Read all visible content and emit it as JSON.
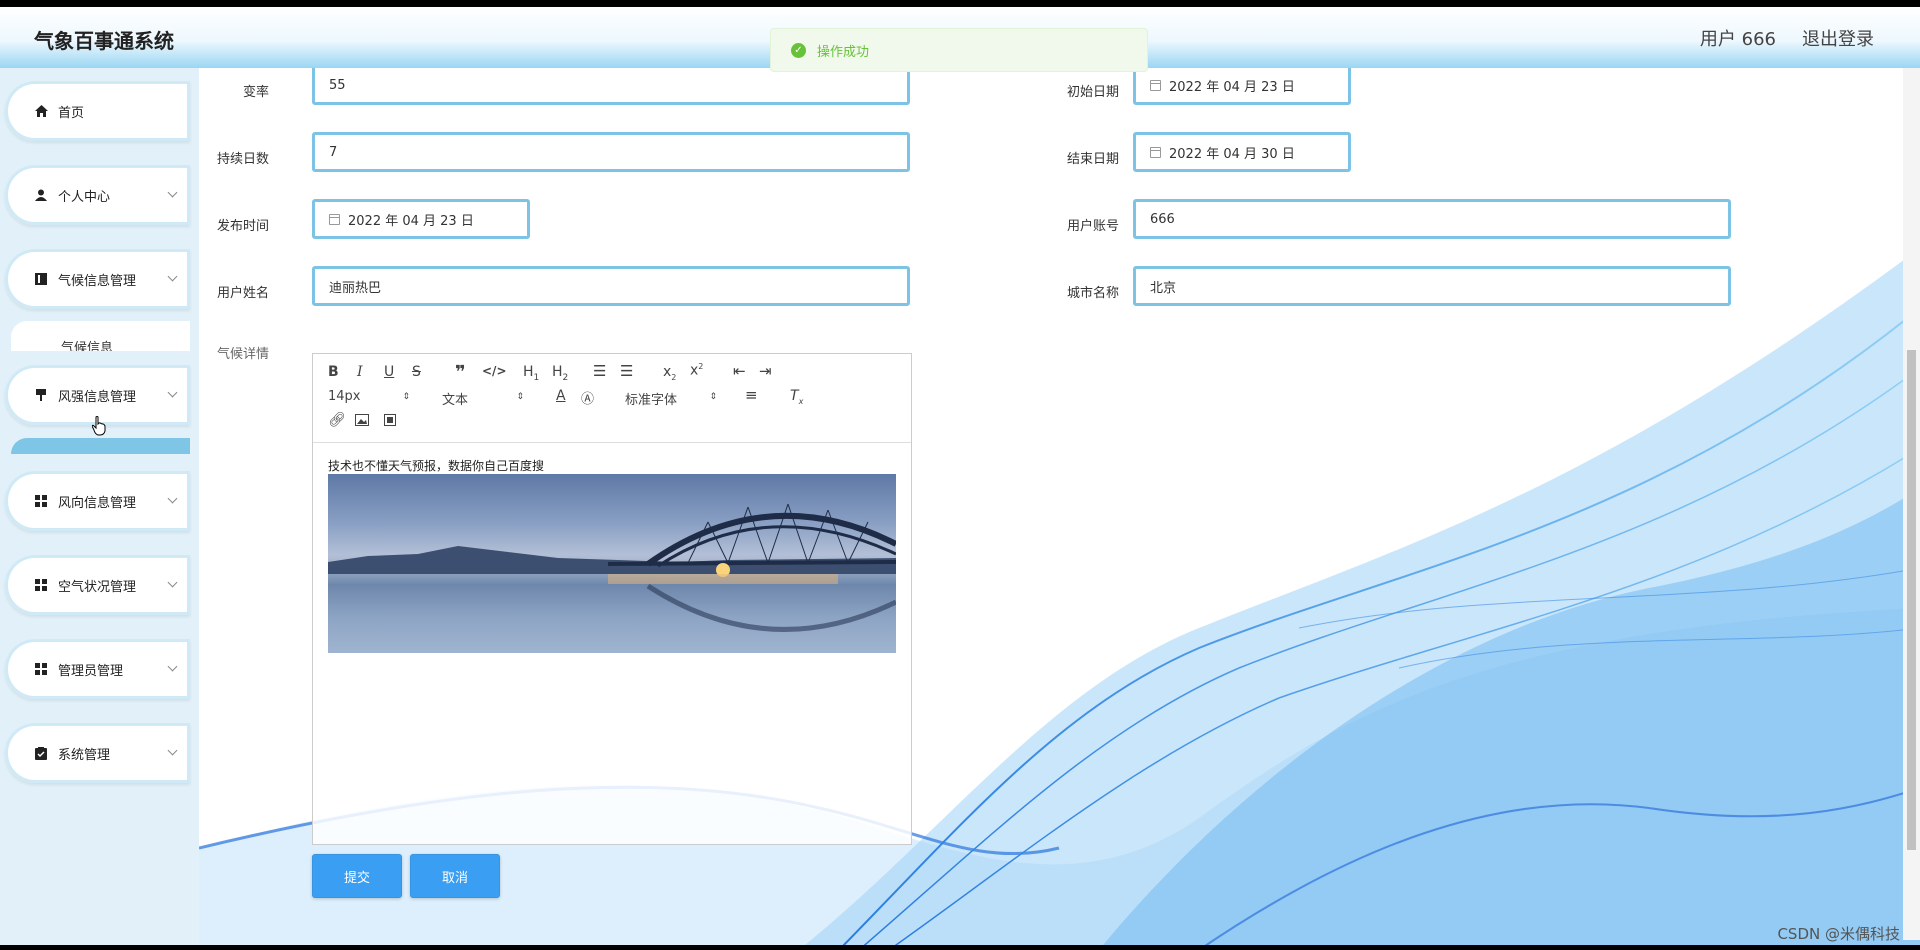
{
  "header": {
    "app_title": "气象百事通系统",
    "user_label": "用户 666",
    "logout_label": "退出登录"
  },
  "toast": {
    "message": "操作成功"
  },
  "sidebar": {
    "items": [
      {
        "label": "首页",
        "icon": "home-icon"
      },
      {
        "label": "个人中心",
        "icon": "user-icon"
      },
      {
        "label": "气候信息管理",
        "icon": "book-icon"
      },
      {
        "label": "风强信息管理",
        "icon": "flag-icon"
      },
      {
        "label": "风向信息管理",
        "icon": "grid-icon"
      },
      {
        "label": "空气状况管理",
        "icon": "grid-icon"
      },
      {
        "label": "管理员管理",
        "icon": "grid-icon"
      },
      {
        "label": "系统管理",
        "icon": "clipboard-icon"
      }
    ],
    "sub_item": "气候信息"
  },
  "form": {
    "rate_label": "变率",
    "rate_value": "55",
    "start_date_label": "初始日期",
    "start_date_value": "2022 年 04 月 23 日",
    "duration_label": "持续日数",
    "duration_value": "7",
    "end_date_label": "结束日期",
    "end_date_value": "2022 年 04 月 30 日",
    "publish_label": "发布时间",
    "publish_value": "2022 年 04 月 23 日",
    "account_label": "用户账号",
    "account_value": "666",
    "name_label": "用户姓名",
    "name_value": "迪丽热巴",
    "city_label": "城市名称",
    "city_value": "北京",
    "detail_label": "气候详情"
  },
  "editor": {
    "font_size": "14px",
    "block_format": "文本",
    "font_family": "标准字体",
    "content_text": "技术也不懂天气预报，数据你自己百度搜"
  },
  "buttons": {
    "submit": "提交",
    "cancel": "取消"
  },
  "watermark": "CSDN @米偶科技",
  "colors": {
    "accent": "#3a9ff2",
    "input_border": "#7cc3e5",
    "sidebar_bg": "#e2f1f9",
    "success": "#67c23a"
  }
}
